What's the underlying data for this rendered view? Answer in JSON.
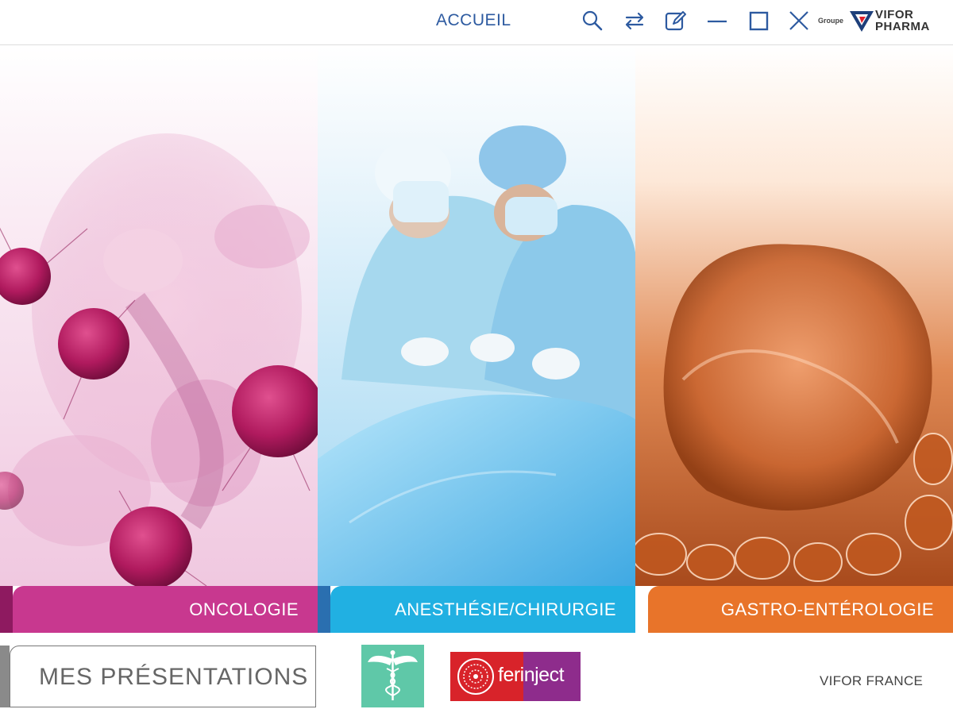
{
  "header": {
    "home_label": "ACCUEIL",
    "brand_prefix": "Groupe",
    "brand_line1": "VIFOR",
    "brand_line2": "PHARMA",
    "icons": [
      "search-icon",
      "sync-icon",
      "edit-icon",
      "minimize-icon",
      "maximize-icon",
      "close-icon"
    ]
  },
  "panels": [
    {
      "label": "ONCOLOGIE",
      "color": "#c8388f",
      "accent": "#8e1a60"
    },
    {
      "label": "ANESTHÉSIE/CHIRURGIE",
      "color": "#21b0e2",
      "accent": "#2a6fb0"
    },
    {
      "label": "GASTRO-ENTÉROLOGIE",
      "color": "#e8742a",
      "accent": "#c9551d"
    }
  ],
  "footer": {
    "presentations_label": "MES PRÉSENTATIONS",
    "ferinject_label": "ferinject",
    "company_label": "VIFOR FRANCE"
  },
  "colors": {
    "nav_blue": "#2d5aa0",
    "caduceus_green": "#5fc8a8",
    "ferinject_red": "#d8232a",
    "ferinject_purple": "#8e2c8c"
  }
}
